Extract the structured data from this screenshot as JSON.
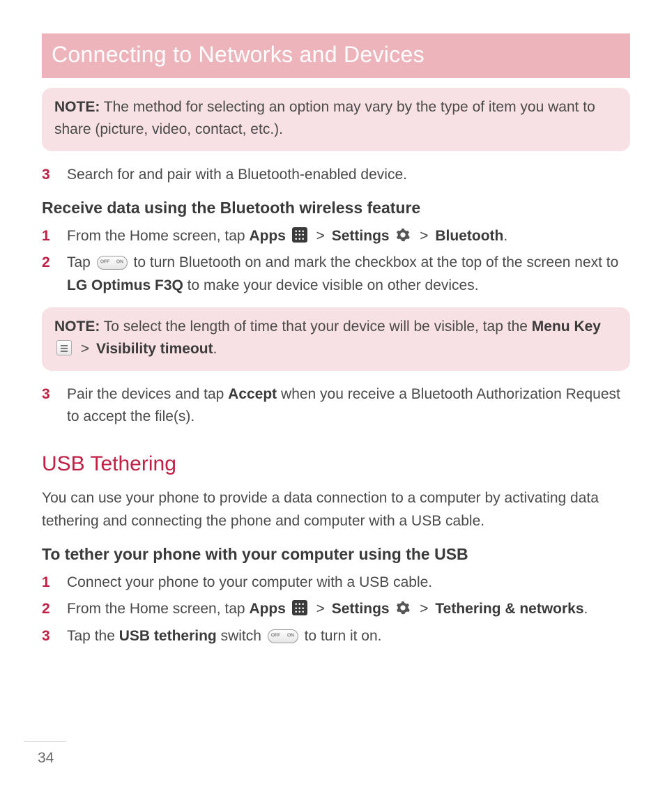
{
  "banner": "Connecting to Networks and Devices",
  "note1": {
    "lead": "NOTE:",
    "text": " The method for selecting an option may vary by the type of item you want to share (picture, video, contact, etc.)."
  },
  "step3a_num": "3",
  "step3a_text": "Search for and pair with a Bluetooth-enabled device.",
  "subhead1": "Receive data using the Bluetooth wireless feature",
  "bt": {
    "s1_num": "1",
    "s1_a": "From the Home screen, tap ",
    "s1_apps": "Apps",
    "s1_settings": "Settings",
    "s1_bluetooth": "Bluetooth",
    "s2_num": "2",
    "s2_a": "Tap ",
    "s2_b": " to turn Bluetooth on and mark the checkbox at the top of the screen next to ",
    "s2_device": "LG Optimus F3Q",
    "s2_c": " to make your device visible on other devices."
  },
  "note2": {
    "lead": "NOTE:",
    "a": " To select the length of time that your device will be visible, tap the ",
    "menu": "Menu Key",
    "vis": "Visibility timeout"
  },
  "bt3": {
    "num": "3",
    "a": "Pair the devices and tap ",
    "accept": "Accept",
    "b": " when you receive a Bluetooth Authorization Request to accept the file(s)."
  },
  "section2": "USB Tethering",
  "usb_intro": "You can use your phone to provide a data connection to a computer by activating data tethering and connecting the phone and computer with a USB cable.",
  "subhead2": "To tether your phone with your computer using the USB",
  "usb": {
    "s1_num": "1",
    "s1": "Connect your phone to your computer with a USB cable.",
    "s2_num": "2",
    "s2_a": "From the Home screen, tap ",
    "s2_apps": "Apps",
    "s2_settings": "Settings",
    "s2_tether": "Tethering & networks",
    "s3_num": "3",
    "s3_a": "Tap the ",
    "s3_usb": "USB tethering",
    "s3_b": " switch ",
    "s3_c": " to turn it on."
  },
  "sep": ">",
  "page": "34"
}
